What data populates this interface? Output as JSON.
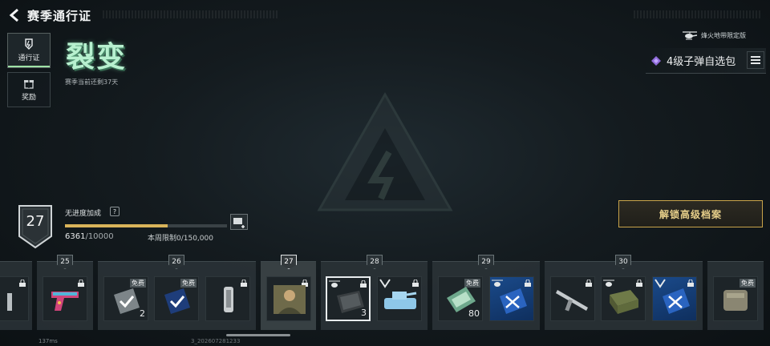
{
  "header": {
    "title": "赛季通行证"
  },
  "nav": [
    {
      "label": "通行证",
      "icon": "pass-icon",
      "active": true
    },
    {
      "label": "奖励",
      "icon": "gift-icon",
      "active": false
    }
  ],
  "season": {
    "name": "裂变",
    "remaining": "赛季当前还剩37天"
  },
  "edition": {
    "label": "烽火地带限定版",
    "icon": "helicopter-icon"
  },
  "pack": {
    "label": "4级子弹自选包",
    "icon": "diamond-icon"
  },
  "progress": {
    "level": "27",
    "boost_label": "无进度加成",
    "help": "?",
    "xp_current": "6361",
    "xp_total": "/10000",
    "xp_fraction": 0.6361,
    "weekly_limit": "本周限制0/150,000"
  },
  "unlock_button": "解锁高级档案",
  "tiers": [
    {
      "num": "25",
      "current": false
    },
    {
      "num": "26",
      "current": false
    },
    {
      "num": "27",
      "current": true
    },
    {
      "num": "28",
      "current": false
    },
    {
      "num": "29",
      "current": false
    },
    {
      "num": "30",
      "current": false
    }
  ],
  "cards": {
    "free": "免费",
    "count_2": "2",
    "count_3": "3",
    "count_80": "80"
  },
  "footer": {
    "ping": "137ms",
    "version": "3_202607281233"
  },
  "colors": {
    "accent_gold": "#c9a44a",
    "progress_fill": "#d9b45a",
    "active_nav": "#9fe3a6"
  }
}
